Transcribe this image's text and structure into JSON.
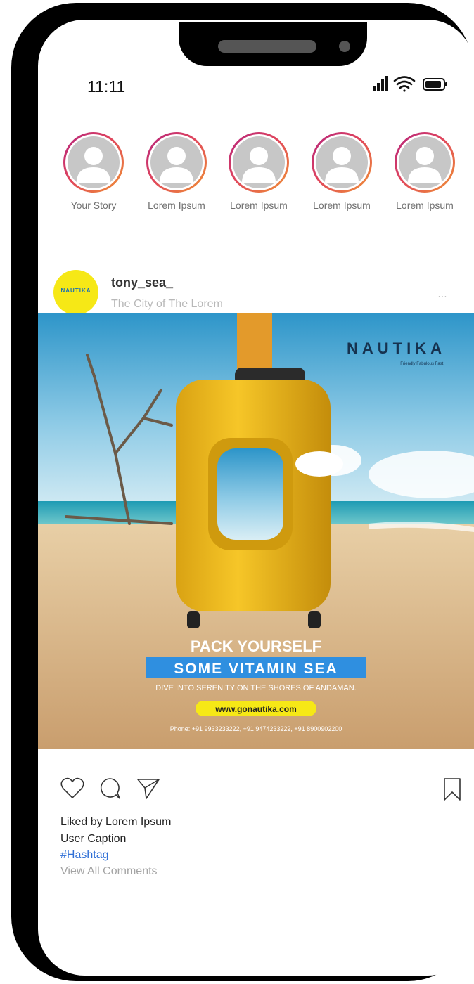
{
  "status_bar": {
    "time": "11:11",
    "icons": [
      "signal-icon",
      "wifi-icon",
      "battery-icon"
    ]
  },
  "stories": [
    {
      "label": "Your Story"
    },
    {
      "label": "Lorem Ipsum"
    },
    {
      "label": "Lorem Ipsum"
    },
    {
      "label": "Lorem Ipsum"
    },
    {
      "label": "Lorem Ipsum"
    }
  ],
  "post": {
    "brand_logo_text": "NAUTIKA",
    "username": "tony_sea_",
    "location": "The City of The Lorem",
    "more_icon": "…",
    "image": {
      "logo_text": "NAUTIKA",
      "logo_tagline": "Friendly Fabulous Fast.",
      "headline": "PACK YOURSELF",
      "highlight": "SOME VITAMIN SEA",
      "subline": "DIVE INTO SERENITY ON THE SHORES OF ANDAMAN.",
      "website": "www.gonautika.com",
      "phone": "Phone: +91 9933233222, +91 9474233222, +91 8900902200"
    },
    "liked_by": "Liked by Lorem Ipsum",
    "caption": "User Caption",
    "hashtag": "#Hashtag",
    "view_comments": "View All Comments"
  },
  "colors": {
    "story_ring_start": "#b3237f",
    "story_ring_end": "#f09433",
    "brand_yellow": "#f6e816",
    "hashtag_blue": "#2f6fd6",
    "highlight_blue": "#2f8fe0"
  }
}
